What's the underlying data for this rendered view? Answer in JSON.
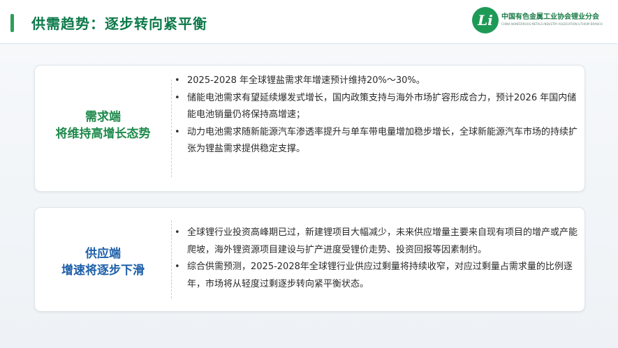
{
  "header": {
    "title": "供需趋势：逐步转向紧平衡",
    "logo": {
      "mark": "Li",
      "name_cn": "中国有色金属工业协会锂业分会",
      "name_en": "CHINA NONFERROUS METALS INDUSTRY ASSOCIATION LITHIUM BRANCH"
    }
  },
  "demand": {
    "title_line1": "需求端",
    "title_line2": "将维持高增长态势",
    "bullets": [
      "2025-2028 年全球锂盐需求年增速预计维持20%～30%。",
      "储能电池需求有望延续爆发式增长，国内政策支持与海外市场扩容形成合力，预计2026 年国内储能电池销量仍将保持高增速；",
      "动力电池需求随新能源汽车渗透率提升与单车带电量增加稳步增长，全球新能源汽车市场的持续扩张为锂盐需求提供稳定支撑。"
    ]
  },
  "supply": {
    "title_line1": "供应端",
    "title_line2": "增速将逐步下滑",
    "bullets": [
      "全球锂行业投资高峰期已过，新建锂项目大幅减少，未来供应增量主要来自现有项目的增产或产能爬坡，海外锂资源项目建设与扩产进度受锂价走势、投资回报等因素制约。",
      "综合供需预测，2025-2028年全球锂行业供应过剩量将持续收窄，对应过剩量占需求量的比例逐年，市场将从轻度过剩逐步转向紧平衡状态。"
    ]
  },
  "colors": {
    "title_green": "#0d7a4a",
    "demand_green": "#1f8a4c",
    "supply_blue": "#1d5fa8",
    "logo_green": "#1e9a57"
  }
}
